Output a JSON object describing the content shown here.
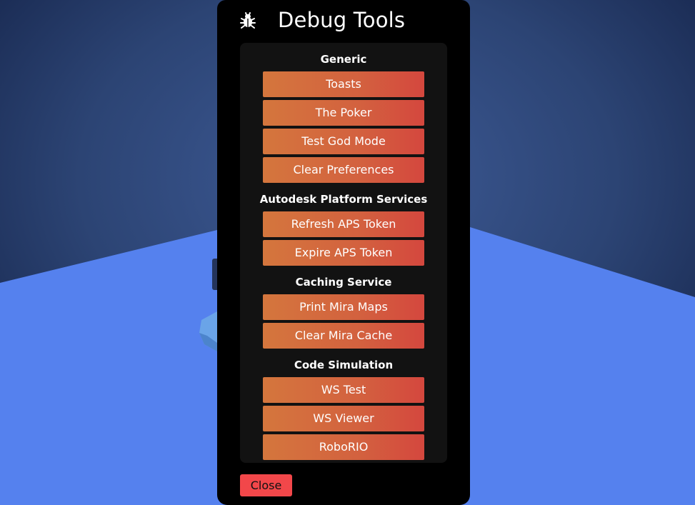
{
  "colors": {
    "wall_top": "#1a2b4e",
    "wall_mid": "#3a5691",
    "floor": "#5581ee",
    "modal_bg": "#000000",
    "panel_bg": "#121212",
    "button_gradient_start": "#d4763d",
    "button_gradient_end": "#d4473e",
    "close_button": "#f2474a"
  },
  "modal": {
    "title": "Debug Tools",
    "icon": "bug-icon",
    "close_label": "Close"
  },
  "sections": [
    {
      "title": "Generic",
      "buttons": [
        "Toasts",
        "The Poker",
        "Test God Mode",
        "Clear Preferences"
      ]
    },
    {
      "title": "Autodesk Platform Services",
      "buttons": [
        "Refresh APS Token",
        "Expire APS Token"
      ]
    },
    {
      "title": "Caching Service",
      "buttons": [
        "Print Mira Maps",
        "Clear Mira Cache"
      ]
    },
    {
      "title": "Code Simulation",
      "buttons": [
        "WS Test",
        "WS Viewer",
        "RoboRIO"
      ]
    }
  ]
}
